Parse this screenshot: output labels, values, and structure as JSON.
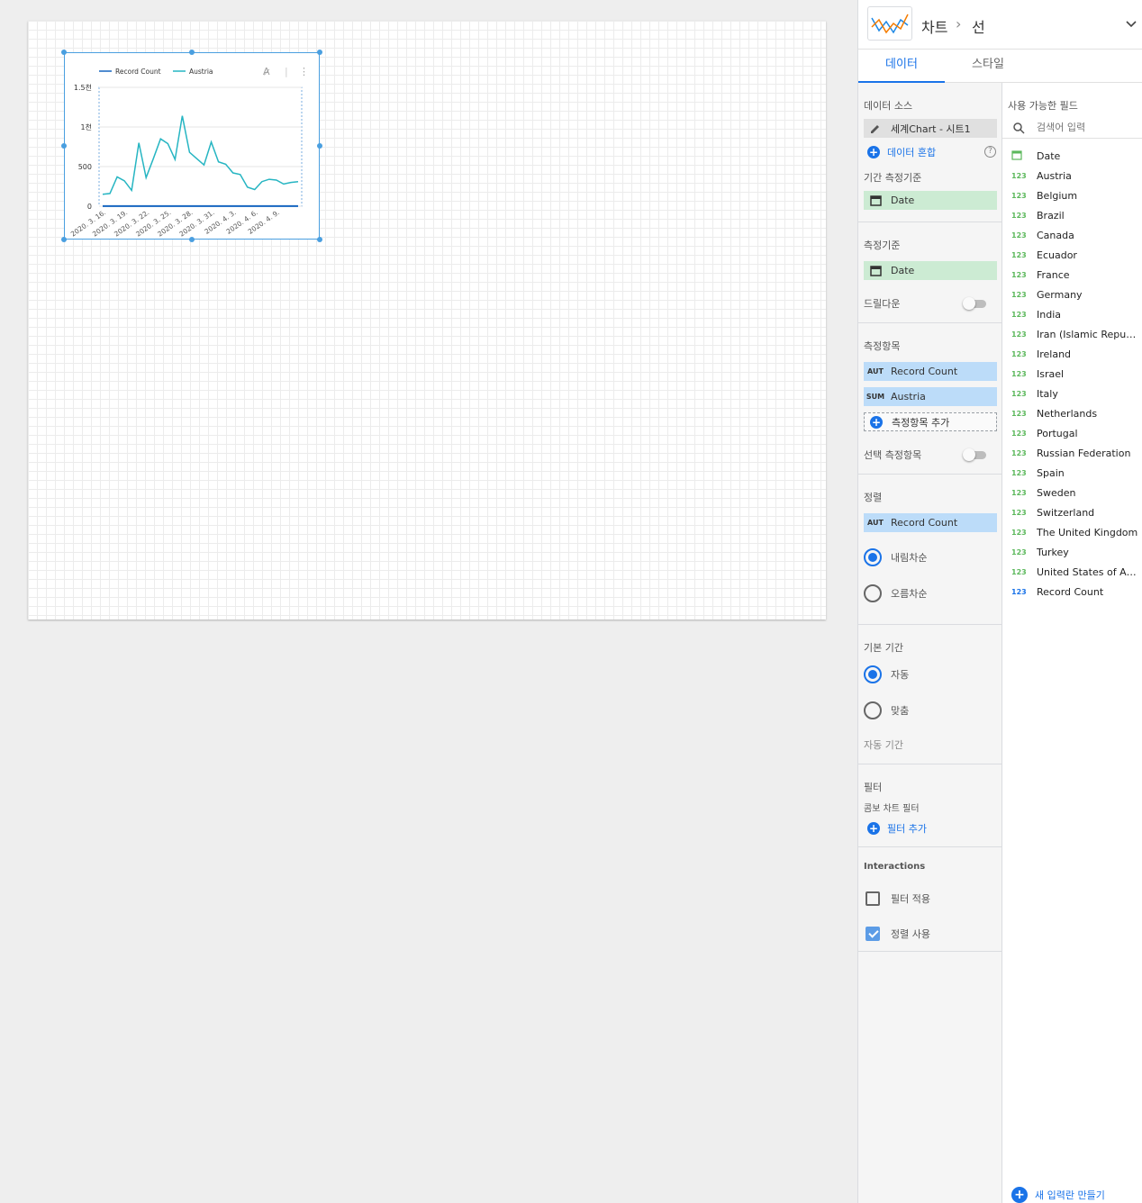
{
  "chart": {
    "toolbar_icons": [
      "ai-icon",
      "more-vert-icon"
    ]
  },
  "chart_data": {
    "type": "line",
    "legend": "top-left",
    "series": [
      {
        "name": "Record Count",
        "color": "#1565c0",
        "values": [
          1,
          1,
          1,
          1,
          1,
          1,
          1,
          1,
          1,
          1,
          1,
          1,
          1,
          1,
          1,
          1,
          1,
          1,
          1,
          1,
          1,
          1,
          1,
          1,
          1,
          1,
          1,
          1
        ]
      },
      {
        "name": "Austria",
        "color": "#26b5c2",
        "values": [
          150,
          160,
          370,
          320,
          200,
          800,
          360,
          600,
          850,
          790,
          590,
          1140,
          680,
          600,
          520,
          810,
          560,
          530,
          420,
          400,
          240,
          210,
          310,
          340,
          330,
          280,
          300,
          310
        ]
      }
    ],
    "x_ticks": [
      "2020. 3. 16.",
      "2020. 3. 19.",
      "2020. 3. 22.",
      "2020. 3. 25.",
      "2020. 3. 28.",
      "2020. 3. 31.",
      "2020. 4. 3.",
      "2020. 4. 6.",
      "2020. 4. 9."
    ],
    "y_ticks": [
      "0",
      "500",
      "1천",
      "1.5천"
    ],
    "ylim": [
      0,
      1500
    ],
    "grid": true
  },
  "header": {
    "breadcrumb_root": "차트",
    "breadcrumb_sep": "›",
    "breadcrumb_leaf": "선",
    "expand_icon": "chevron-down-icon"
  },
  "tabs": {
    "data": "데이터",
    "style": "스타일"
  },
  "setup": {
    "data_source_title": "데이터 소스",
    "data_source_name": "세계Chart - 시트1",
    "blend_label": "데이터 혼합",
    "date_range_dim_title": "기간 측정기준",
    "date_range_dim": "Date",
    "dimension_title": "측정기준",
    "dimension": "Date",
    "drilldown_label": "드릴다운",
    "metrics_title": "측정항목",
    "metrics": [
      {
        "agg": "AUT",
        "name": "Record Count"
      },
      {
        "agg": "SUM",
        "name": "Austria"
      }
    ],
    "add_metric": "측정항목 추가",
    "optional_metrics": "선택 측정항목",
    "sort_title": "정렬",
    "sort_agg": "AUT",
    "sort_field": "Record Count",
    "sort_desc": "내림차순",
    "sort_asc": "오름차순",
    "default_range_title": "기본 기간",
    "range_auto": "자동",
    "range_custom": "맞춤",
    "auto_range_label": "자동 기간",
    "filter_title": "필터",
    "combo_filter": "콤보 차트 필터",
    "add_filter": "필터 추가",
    "interactions_title": "Interactions",
    "apply_filter": "필터 적용",
    "enable_sort": "정렬 사용"
  },
  "available": {
    "title": "사용 가능한 필드",
    "search_placeholder": "검색어 입력",
    "type_number": "123",
    "fields": [
      "Austria",
      "Belgium",
      "Brazil",
      "Canada",
      "Ecuador",
      "France",
      "Germany",
      "India",
      "Iran (Islamic Republic of)",
      "Ireland",
      "Israel",
      "Italy",
      "Netherlands",
      "Portugal",
      "Russian Federation",
      "Spain",
      "Sweden",
      "Switzerland",
      "The United Kingdom",
      "Turkey",
      "United States of America"
    ],
    "date_field": "Date",
    "record_count": "Record Count",
    "create_field": "새 입력란 만들기"
  }
}
